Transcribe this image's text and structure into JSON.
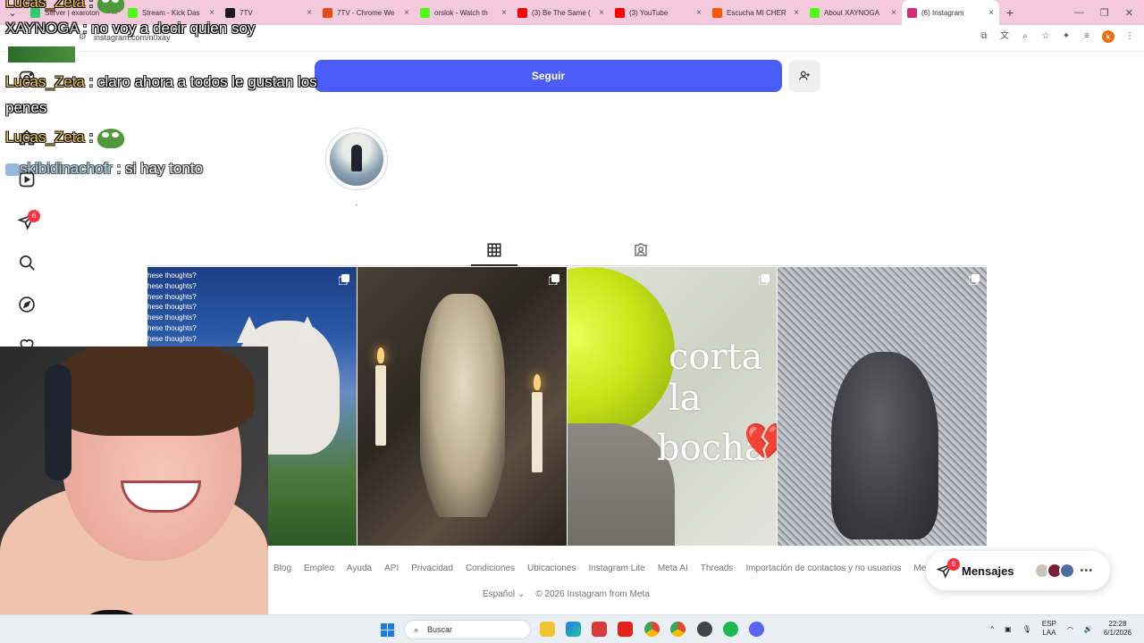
{
  "browser": {
    "tabs": [
      {
        "label": "Server | exaroton",
        "color": "#2ecc71"
      },
      {
        "label": "Stream - Kick Das",
        "color": "#53fc18"
      },
      {
        "label": "7TV",
        "color": "#1a1a1a"
      },
      {
        "label": "7TV - Chrome We",
        "color": "#e64a19"
      },
      {
        "label": "orslok - Watch th",
        "color": "#53fc18"
      },
      {
        "label": "(3) Be The Same (",
        "color": "#ff0000"
      },
      {
        "label": "(3) YouTube",
        "color": "#ff0000"
      },
      {
        "label": "Escucha MI CHER",
        "color": "#ff5500"
      },
      {
        "label": "About XAYNOGA",
        "color": "#53fc18"
      },
      {
        "label": "(6) Instagram",
        "color": "#d62976"
      }
    ],
    "url": "instagram.com/n0xay"
  },
  "chat": [
    {
      "user": "Lucas_Zeta",
      "text": "",
      "emote": true
    },
    {
      "user": "XAYNOGA",
      "text": "no voy a decir quien soy"
    },
    {
      "user": "Lucas_Zeta",
      "text": "claro ahora a todos le gustan los"
    },
    {
      "user": "",
      "text": "penes"
    },
    {
      "user": "Lucas_Zeta",
      "text": "",
      "emote": true
    },
    {
      "user": "skibidinachofr",
      "text": "si hay tonto"
    }
  ],
  "sidebar": {
    "badge_count": "6",
    "icons": [
      "instagram-icon",
      "home-icon",
      "reels-icon",
      "messages-icon",
      "search-icon",
      "explore-icon",
      "notifications-icon",
      "create-icon",
      "dashboard-icon",
      "profile-avatar"
    ]
  },
  "profile": {
    "follow_label": "Seguir",
    "highlight_label": "."
  },
  "posts": [
    {
      "caption_lines": [
        "hese thoughts?",
        "hese thoughts?",
        "hese thoughts?",
        "hese thoughts?",
        "hese thoughts?",
        "hese thoughts?",
        "hese thoughts?"
      ]
    },
    {
      "caption_lines": []
    },
    {
      "text1": "corta la",
      "text2": "bocha",
      "emoji": "💔"
    },
    {
      "caption_lines": []
    }
  ],
  "footer": {
    "links": [
      "Blog",
      "Empleo",
      "Ayuda",
      "API",
      "Privacidad",
      "Condiciones",
      "Ubicaciones",
      "Instagram Lite",
      "Meta AI",
      "Threads",
      "Importación de contactos y no usuarios",
      "Meta V"
    ],
    "language": "Español",
    "copyright": "© 2026 Instagram from Meta"
  },
  "messages": {
    "label": "Mensajes",
    "badge": "6"
  },
  "taskbar": {
    "search_label": "Buscar",
    "lang_top": "ESP",
    "lang_bottom": "LAA",
    "time": "22:28",
    "date": "6/1/2026"
  },
  "colors": {
    "follow_button": "#4a5df9",
    "badge": "#ff3040",
    "tabstrip": "#f3c9dc"
  }
}
